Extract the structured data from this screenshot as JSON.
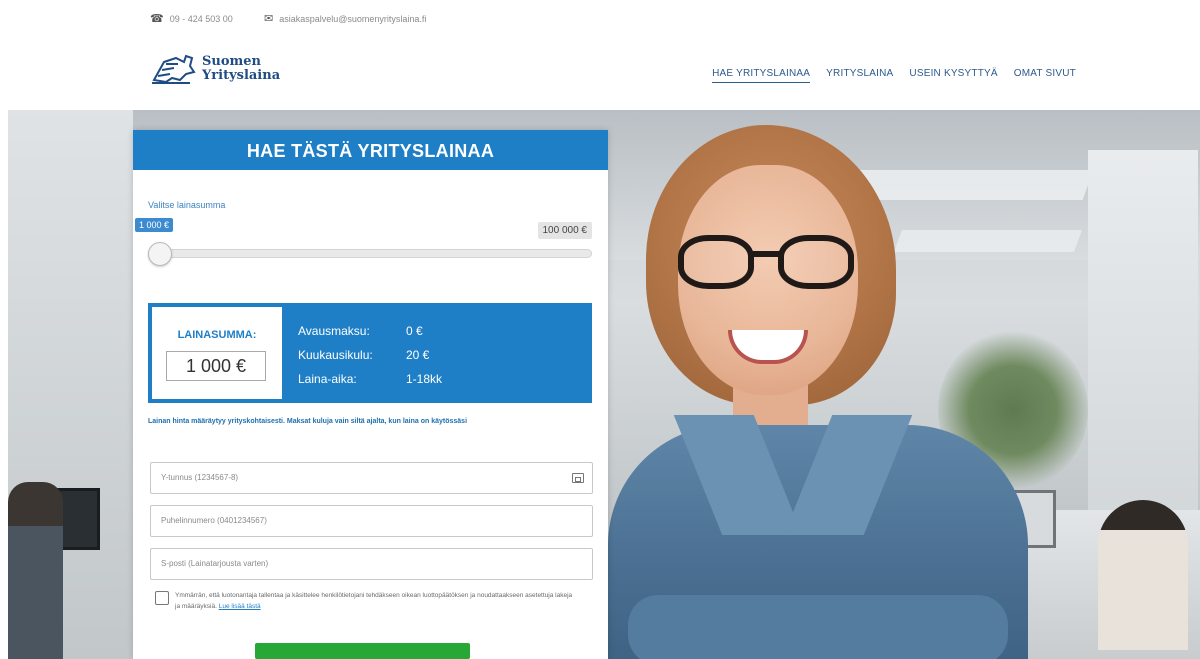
{
  "topbar": {
    "phone": "09 - 424 503 00",
    "email": "asiakaspalvelu@suomenyrityslaina.fi",
    "phone_icon": "phone-icon",
    "email_icon": "email-icon"
  },
  "logo": {
    "line1": "Suomen",
    "line2": "Yrityslaina"
  },
  "nav": {
    "items": [
      {
        "label": "HAE YRITYSLAINAA",
        "active": true
      },
      {
        "label": "YRITYSLAINA",
        "active": false
      },
      {
        "label": "USEIN KYSYTTYÄ",
        "active": false
      },
      {
        "label": "OMAT SIVUT",
        "active": false
      }
    ]
  },
  "form": {
    "title": "HAE TÄSTÄ YRITYSLAINAA",
    "amount_label": "Valitse lainasumma",
    "slider": {
      "min_label": "1 000 €",
      "max_label": "100 000 €",
      "value_fraction": 0.0
    },
    "summary": {
      "title": "LAINASUMMA:",
      "value": "1 000 €",
      "rows": [
        {
          "key": "Avausmaksu:",
          "value": "0 €"
        },
        {
          "key": "Kuukausikulu:",
          "value": "20 €"
        },
        {
          "key": "Laina-aika:",
          "value": "1-18kk"
        }
      ]
    },
    "notice": "Lainan hinta määräytyy yrityskohtaisesti. Maksat kuluja vain siltä ajalta, kun laina on käytössäsi",
    "fields": {
      "business_id_placeholder": "Y-tunnus (1234567-8)",
      "phone_placeholder": "Puhelinnumero (0401234567)",
      "email_placeholder": "S-posti (Lainatarjousta varten)"
    },
    "consent": {
      "text": "Ymmärrän, että luotonantaja tallentaa ja käsittelee henkilötietojani tehdäkseen oikean luottopäätöksen ja noudattaakseen asetettuja lakeja ja määräyksiä.",
      "link": "Lue lisää tästä"
    }
  },
  "colors": {
    "brand_blue": "#1f7fc6",
    "nav_blue": "#2c5a8c",
    "submit_green": "#27a836"
  }
}
